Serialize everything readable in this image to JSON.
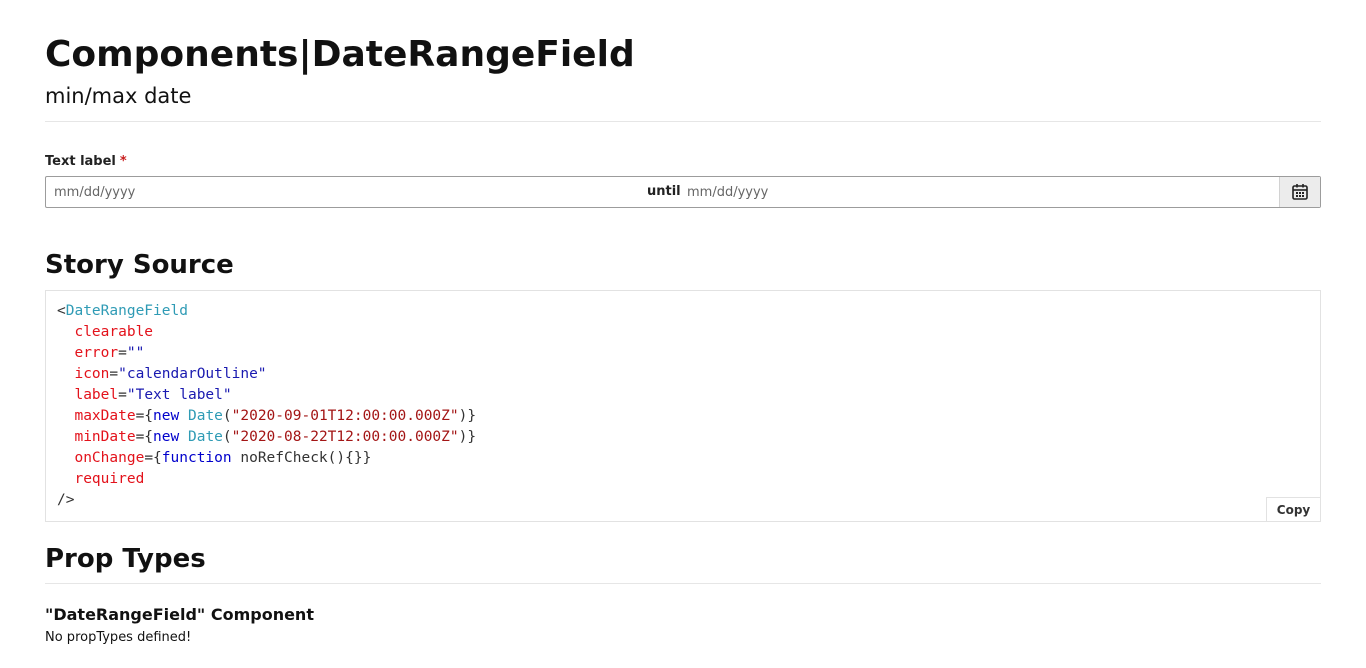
{
  "header": {
    "title": "Components|DateRangeField",
    "subtitle": "min/max date"
  },
  "field": {
    "label": "Text label",
    "required_marker": "*",
    "start_placeholder": "mm/dd/yyyy",
    "separator": "until",
    "end_placeholder": "mm/dd/yyyy",
    "icon": "calendar-icon"
  },
  "story_source": {
    "heading": "Story Source",
    "copy_label": "Copy",
    "code": {
      "open": "<",
      "component": "DateRangeField",
      "clearable": "clearable",
      "error_attr": "error",
      "error_value": "\"\"",
      "icon_attr": "icon",
      "icon_value": "\"calendarOutline\"",
      "label_attr": "label",
      "label_value": "\"Text label\"",
      "max_attr": "maxDate",
      "max_value": "\"2020-09-01T12:00:00.000Z\"",
      "min_attr": "minDate",
      "min_value": "\"2020-08-22T12:00:00.000Z\"",
      "onchange_attr": "onChange",
      "kw_new": "new",
      "kw_date": "Date",
      "kw_function": "function",
      "fn_name": " noRefCheck(){}",
      "required": "required",
      "close": "/>"
    }
  },
  "prop_types": {
    "heading": "Prop Types",
    "component_title": "\"DateRangeField\" Component",
    "empty_message": "No propTypes defined!"
  },
  "colors": {
    "required": "#c81e1e",
    "tag": "#2f9bb5",
    "attr": "#e3121b",
    "string": "#1a1ab0",
    "keyword": "#0000cc",
    "date_string": "#a31515"
  }
}
